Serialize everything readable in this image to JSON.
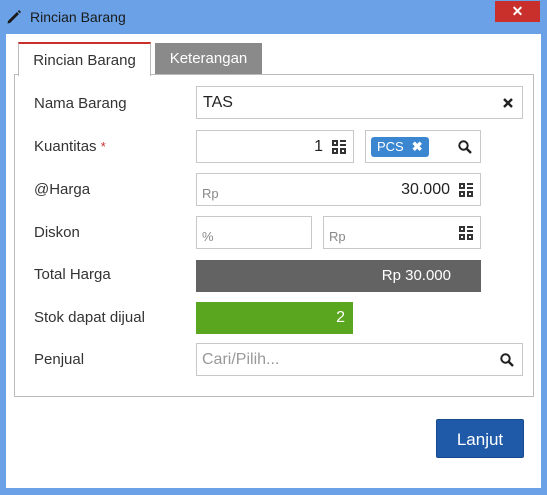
{
  "window": {
    "title": "Rincian Barang",
    "close_label": "✕"
  },
  "tabs": [
    {
      "label": "Rincian Barang",
      "active": true
    },
    {
      "label": "Keterangan",
      "active": false
    }
  ],
  "form": {
    "nama_barang": {
      "label": "Nama Barang",
      "value": "TAS"
    },
    "kuantitas": {
      "label": "Kuantitas",
      "required_mark": "*",
      "value": "1",
      "unit": "PCS"
    },
    "harga": {
      "label": "@Harga",
      "prefix": "Rp",
      "value": "30.000"
    },
    "diskon": {
      "label": "Diskon",
      "percent_placeholder": "%",
      "amount_placeholder": "Rp"
    },
    "total_harga": {
      "label": "Total Harga",
      "value": "Rp 30.000"
    },
    "stok": {
      "label": "Stok dapat dijual",
      "value": "2"
    },
    "penjual": {
      "label": "Penjual",
      "placeholder": "Cari/Pilih..."
    }
  },
  "buttons": {
    "lanjut": "Lanjut"
  },
  "colors": {
    "titlebar": "#6aa1e7",
    "close": "#c9302c",
    "chip": "#3b86d1",
    "total": "#636363",
    "stok": "#5aa61f",
    "primary": "#1e5aa8"
  }
}
